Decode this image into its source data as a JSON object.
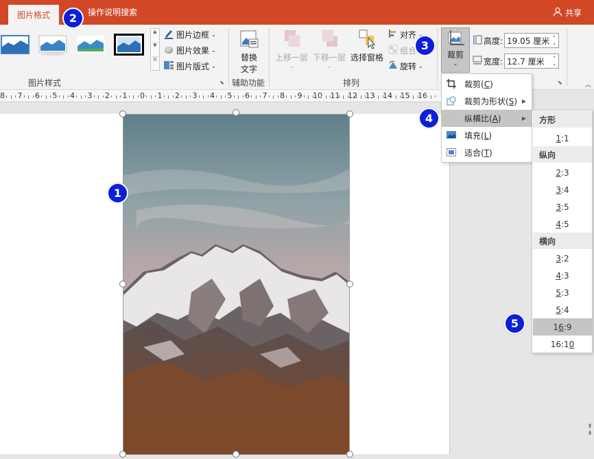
{
  "tabs": {
    "active": "图片格式",
    "search": "操作说明搜索",
    "share": "共享"
  },
  "ribbon": {
    "picture_styles": {
      "label": "图片样式",
      "border": "图片边框",
      "effects": "图片效果",
      "layout": "图片版式"
    },
    "accessibility": {
      "label": "辅助功能",
      "alt_text_line1": "替换",
      "alt_text_line2": "文字"
    },
    "arrange": {
      "label": "排列",
      "bring_forward": "上移一层",
      "send_backward": "下移一层",
      "selection_pane": "选择窗格",
      "align": "对齐",
      "group": "组合",
      "rotate": "旋转"
    },
    "size": {
      "crop": "裁剪",
      "height_label": "高度:",
      "height_value": "19.05 厘米",
      "width_label": "宽度:",
      "width_value": "12.7 厘米"
    }
  },
  "ruler": {
    "labels": [
      "8",
      "7",
      "6",
      "5",
      "4",
      "3",
      "2",
      "1",
      "0",
      "1",
      "2",
      "3",
      "4",
      "5",
      "6",
      "7",
      "8",
      "9",
      "10",
      "11",
      "12",
      "13",
      "14",
      "15",
      "16"
    ]
  },
  "crop_menu": {
    "items": [
      {
        "label": "裁剪(",
        "key": "C",
        "suffix": ")"
      },
      {
        "label": "裁剪为形状(",
        "key": "S",
        "suffix": ")"
      },
      {
        "label": "纵横比(",
        "key": "A",
        "suffix": ")"
      },
      {
        "label": "填充(",
        "key": "L",
        "suffix": ")"
      },
      {
        "label": "适合(",
        "key": "T",
        "suffix": ")"
      }
    ]
  },
  "aspect_submenu": {
    "square_header": "方形",
    "square": [
      {
        "k": "1",
        "rest": ":1"
      }
    ],
    "portrait_header": "纵向",
    "portrait": [
      {
        "k": "2",
        "rest": ":3"
      },
      {
        "k": "3",
        "rest": ":4"
      },
      {
        "k": "3",
        "rest": ":5"
      },
      {
        "k": "4",
        "rest": ":5"
      }
    ],
    "landscape_header": "横向",
    "landscape": [
      {
        "k": "3",
        "rest": ":2",
        "pre": ""
      },
      {
        "k": "4",
        "rest": ":3",
        "pre": ""
      },
      {
        "k": "5",
        "rest": ":3",
        "pre": ""
      },
      {
        "k": "5",
        "rest": ":4",
        "pre": ""
      },
      {
        "k": "6",
        "rest": ":9",
        "pre": "1"
      },
      {
        "k": "0",
        "rest": "",
        "pre": "16:1"
      }
    ],
    "selected": "16:9"
  },
  "callouts": [
    "1",
    "2",
    "3",
    "4",
    "5"
  ]
}
